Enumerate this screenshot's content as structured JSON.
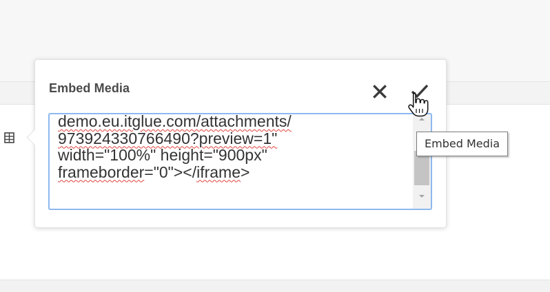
{
  "popover": {
    "title": "Embed Media",
    "close_icon": "close-icon",
    "confirm_icon": "check-icon"
  },
  "textarea": {
    "visible_lines": [
      [
        {
          "t": "demo.eu.itglue.com/attachments/",
          "sp": true
        }
      ],
      [
        {
          "t": "973924330766490?preview=1\"",
          "sp": true
        }
      ],
      [
        {
          "t": "width=\"100%\" height=\"900px\"",
          "sp": false
        }
      ],
      [
        {
          "t": "frameborder",
          "sp": true
        },
        {
          "t": "=\"0\"></",
          "sp": false
        },
        {
          "t": "iframe",
          "sp": true
        },
        {
          "t": ">",
          "sp": false
        }
      ]
    ]
  },
  "tooltip": {
    "text": "Embed Media"
  },
  "toolbar": {
    "table_icon": "table-icon"
  },
  "cursor": {
    "type": "hand-pointer-icon"
  },
  "colors": {
    "focus_border": "#8db8f0",
    "spellcheck_underline": "#e0413b",
    "title_text": "#4a4a4a"
  }
}
